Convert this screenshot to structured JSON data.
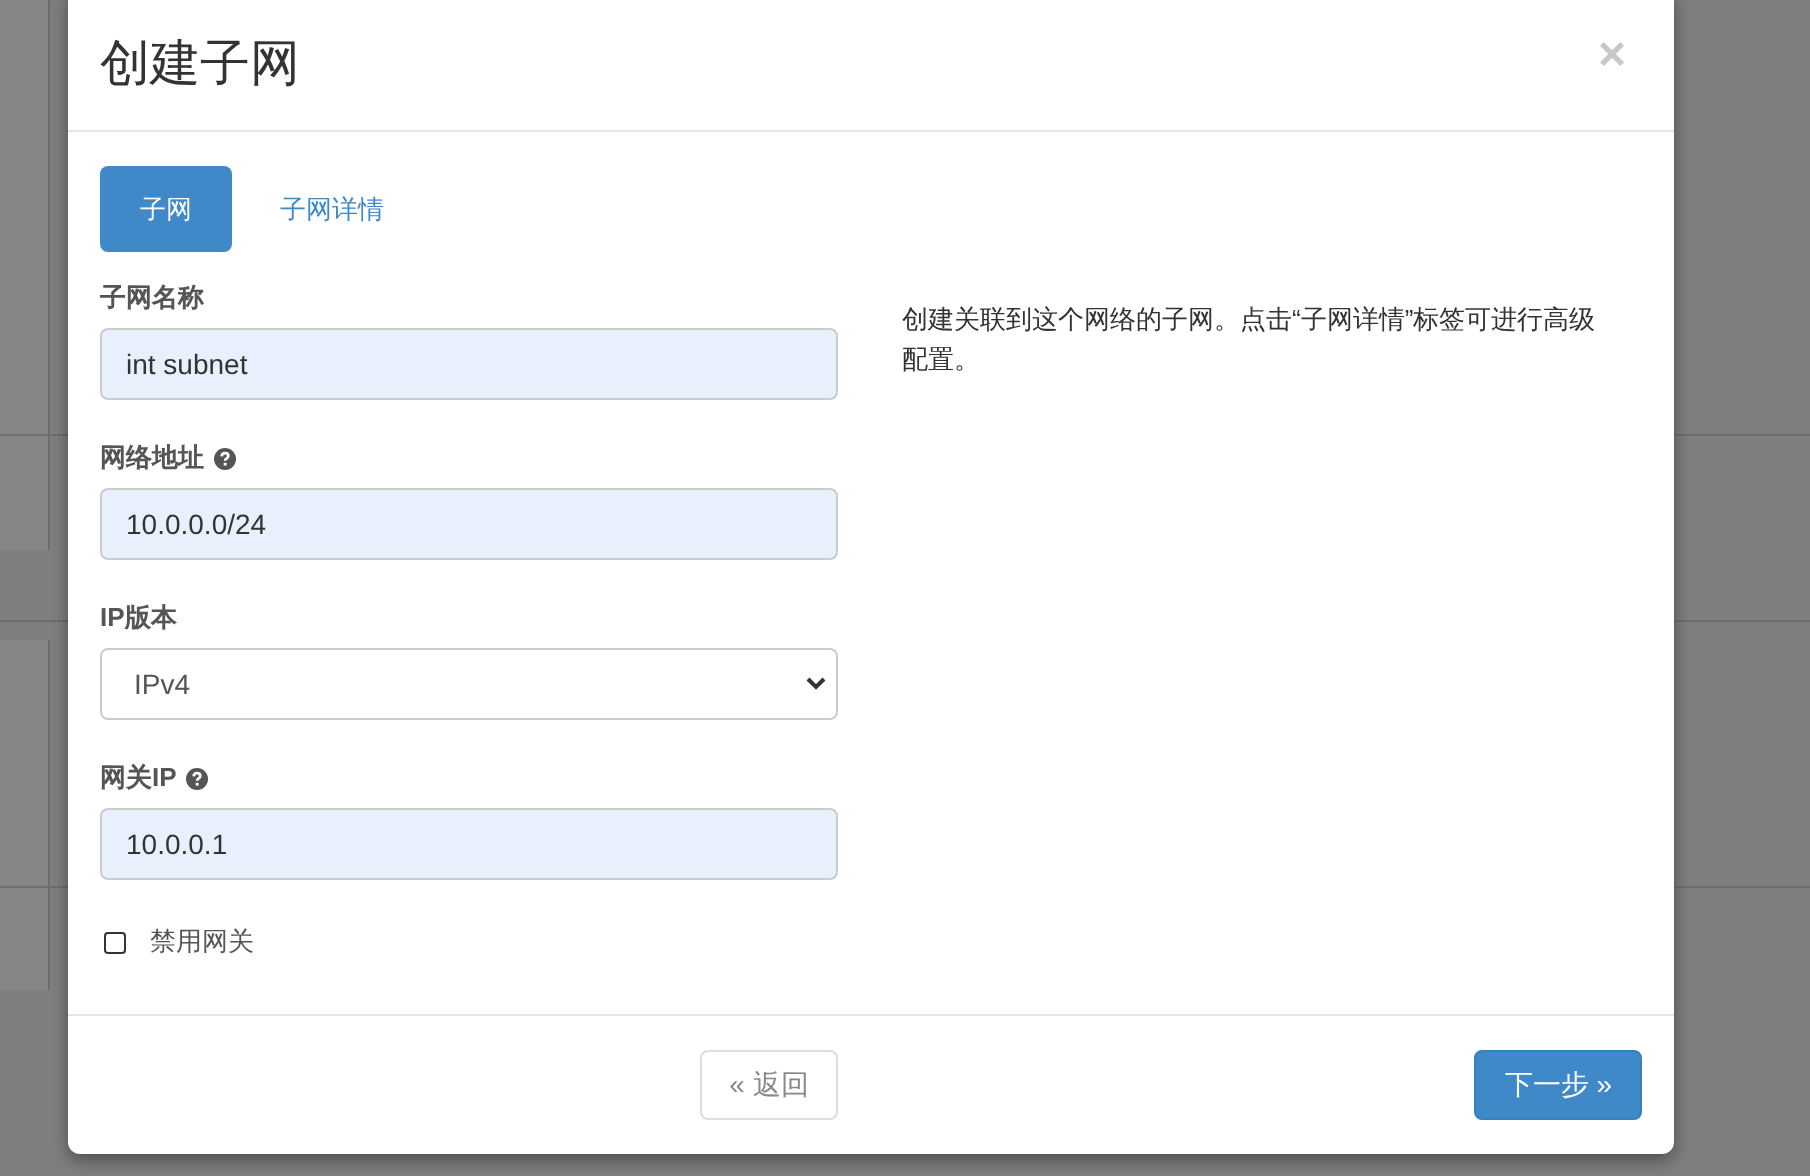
{
  "dialog": {
    "title": "创建子网",
    "close": "×"
  },
  "tabs": [
    {
      "label": "子网",
      "selected": true
    },
    {
      "label": "子网详情",
      "selected": false
    }
  ],
  "fields": [
    {
      "kind": "text",
      "label": "子网名称",
      "help": false,
      "value": "int subnet"
    },
    {
      "kind": "text",
      "label": "网络地址",
      "help": true,
      "value": "10.0.0.0/24"
    },
    {
      "kind": "select",
      "label": "IP版本",
      "help": false,
      "value": "IPv4"
    },
    {
      "kind": "text",
      "label": "网关IP",
      "help": true,
      "value": "10.0.0.1"
    },
    {
      "kind": "checkbox",
      "label": "禁用网关",
      "checked": false
    }
  ],
  "description": "创建关联到这个网络的子网。点击“子网详情”标签可进行高级配置。",
  "buttons": [
    {
      "label": "« 返回",
      "kind": "back"
    },
    {
      "label": "下一步 »",
      "kind": "primary"
    }
  ]
}
